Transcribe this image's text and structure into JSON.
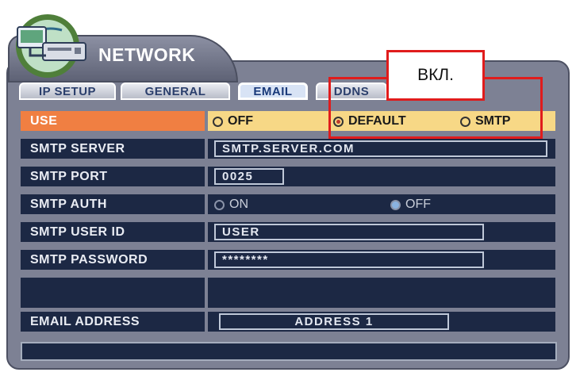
{
  "window": {
    "title": "NETWORK"
  },
  "tabs": [
    {
      "label": "IP SETUP",
      "active": false
    },
    {
      "label": "GENERAL",
      "active": false
    },
    {
      "label": "EMAIL",
      "active": true
    },
    {
      "label": "DDNS",
      "active": false
    }
  ],
  "settings": {
    "use": {
      "label": "USE",
      "options": [
        "OFF",
        "DEFAULT",
        "SMTP"
      ],
      "selected": "DEFAULT"
    },
    "smtp_server": {
      "label": "SMTP SERVER",
      "value": "SMTP.SERVER.COM"
    },
    "smtp_port": {
      "label": "SMTP PORT",
      "value": "0025"
    },
    "smtp_auth": {
      "label": "SMTP AUTH",
      "options": [
        "ON",
        "OFF"
      ],
      "selected": "OFF"
    },
    "smtp_user_id": {
      "label": "SMTP USER ID",
      "value": "USER"
    },
    "smtp_password": {
      "label": "SMTP PASSWORD",
      "value": "********"
    },
    "email_address": {
      "label": "EMAIL ADDRESS",
      "value": "ADDRESS 1"
    }
  },
  "annotation": {
    "callout_text": "ВКЛ."
  },
  "colors": {
    "panel": "#7d8194",
    "cell": "#1c2844",
    "use_label": "#f07f42",
    "use_value": "#f7d886",
    "highlight": "#e01c1c"
  }
}
